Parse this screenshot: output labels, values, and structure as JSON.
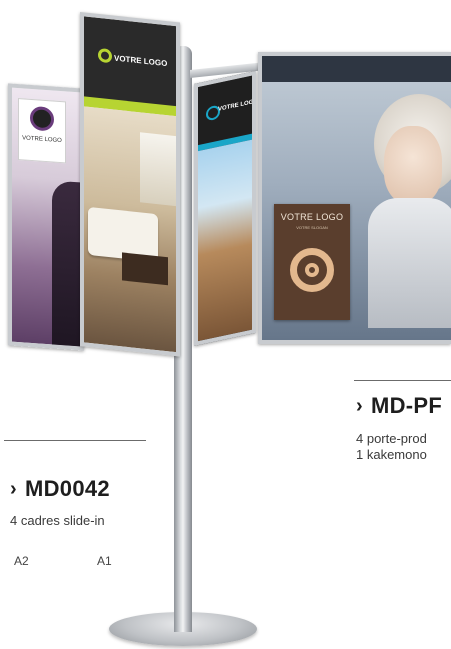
{
  "panels": {
    "main_logo_text": "VOTRE LOGO",
    "center_logo_text": "VOTRE LOGO",
    "left_logo_text": "VOTRE LOGO",
    "right_card_title": "VOTRE LOGO",
    "right_card_subtitle": "VOTRE SLOGAN"
  },
  "product_left": {
    "chevron": "›",
    "code": "MD0042",
    "description": "4 cadres slide-in",
    "sizes": [
      "A2",
      "A1"
    ]
  },
  "product_right": {
    "chevron": "›",
    "code": "MD-PF",
    "description_lines": [
      "4 porte-prod",
      "1 kakemono"
    ]
  },
  "colors": {
    "accent_green": "#b7d432",
    "accent_cyan": "#1aa6c8",
    "text_dark": "#1e1e1e"
  }
}
